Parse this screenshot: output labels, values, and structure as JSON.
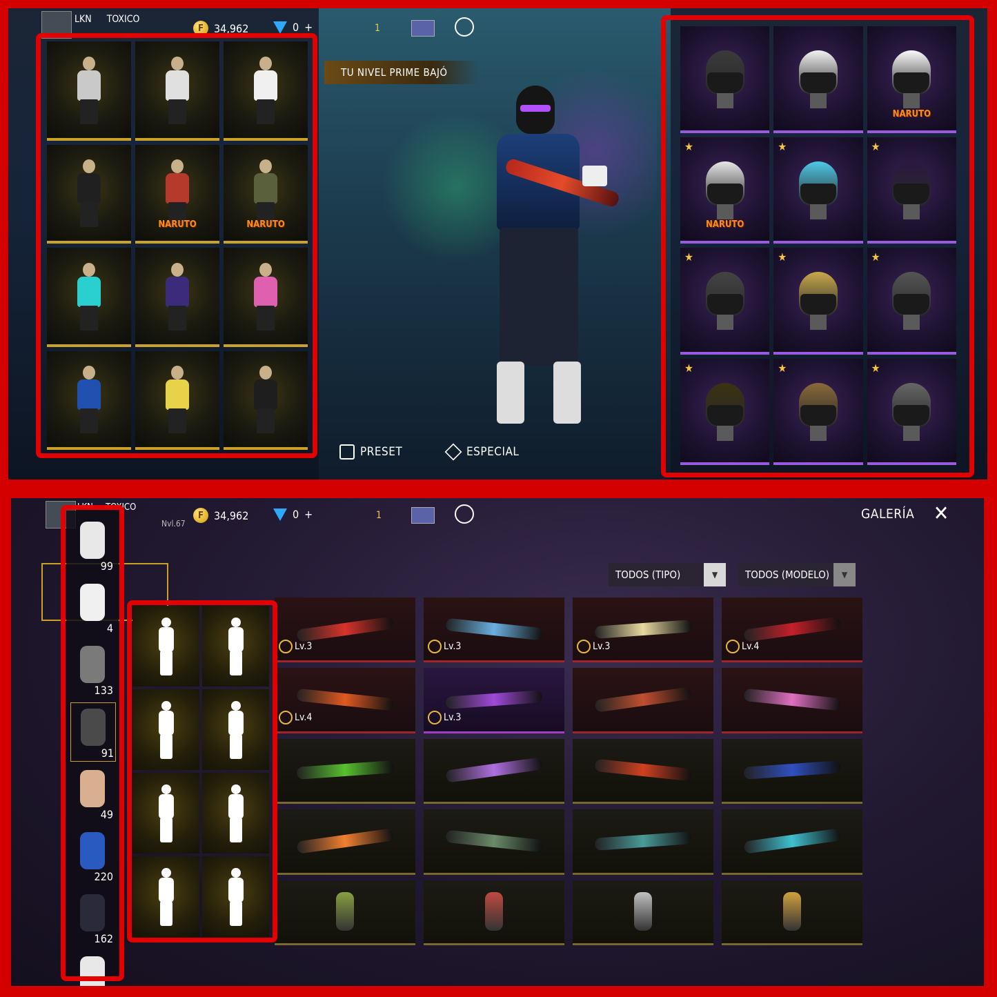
{
  "top": {
    "player": {
      "tag": "LKN",
      "name": "TOXICO"
    },
    "coins": "34,962",
    "diamonds": "0",
    "diamonds_plus": "+",
    "rank_level": "1",
    "banner": "TU NIVEL PRIME BAJÓ",
    "buttons": {
      "preset": "PRESET",
      "special": "ESPECIAL"
    },
    "outfit_tiles": [
      {
        "icon": "outfit-icon"
      },
      {
        "icon": "outfit-icon"
      },
      {
        "icon": "outfit-icon"
      },
      {
        "icon": "outfit-icon"
      },
      {
        "icon": "outfit-icon",
        "badge": "NARUTO"
      },
      {
        "icon": "outfit-icon",
        "badge": "NARUTO"
      },
      {
        "icon": "outfit-icon"
      },
      {
        "icon": "outfit-icon"
      },
      {
        "icon": "outfit-icon"
      },
      {
        "icon": "outfit-icon"
      },
      {
        "icon": "outfit-icon"
      },
      {
        "icon": "outfit-icon"
      }
    ],
    "head_tiles": [
      {
        "star": false
      },
      {
        "star": false
      },
      {
        "star": false,
        "badge": "NARUTO"
      },
      {
        "star": true,
        "badge": "NARUTO"
      },
      {
        "star": true
      },
      {
        "star": true
      },
      {
        "star": true
      },
      {
        "star": true
      },
      {
        "star": true
      },
      {
        "star": true
      },
      {
        "star": true
      },
      {
        "star": true
      }
    ]
  },
  "bottom": {
    "player": {
      "tag": "LKN",
      "name": "TOXICO",
      "level": "Nvl.67"
    },
    "coins": "34,962",
    "diamonds": "0",
    "diamonds_plus": "+",
    "rank_level": "1",
    "title": "GALERÍA",
    "filters": {
      "type": "TODOS (TIPO)",
      "model": "TODOS (MODELO)"
    },
    "categories": [
      {
        "icon": "outfit-set-icon",
        "count": "99"
      },
      {
        "icon": "jumpsuit-icon",
        "count": "4"
      },
      {
        "icon": "head-icon",
        "count": "133"
      },
      {
        "icon": "mask-icon",
        "count": "91"
      },
      {
        "icon": "face-icon",
        "count": "49"
      },
      {
        "icon": "jacket-icon",
        "count": "220"
      },
      {
        "icon": "pants-icon",
        "count": "162"
      },
      {
        "icon": "shoes-icon",
        "count": ""
      }
    ],
    "emote_tiles": [
      {
        "icon": "emote-heart-icon"
      },
      {
        "icon": "emote-drink-icon"
      },
      {
        "icon": "emote-dance-icon"
      },
      {
        "icon": "emote-beach-chair-icon"
      },
      {
        "icon": "emote-lotus-icon"
      },
      {
        "icon": "emote-broken-heart-icon"
      },
      {
        "icon": "emote-car-icon"
      },
      {
        "icon": "emote-cheer-icon"
      }
    ],
    "weapon_tiles": [
      {
        "level": "Lv.3",
        "style": "red"
      },
      {
        "level": "Lv.3",
        "style": "red"
      },
      {
        "level": "Lv.3",
        "style": "red"
      },
      {
        "level": "Lv.4",
        "style": "red"
      },
      {
        "level": "Lv.4",
        "style": "red"
      },
      {
        "level": "Lv.3",
        "style": "violet"
      },
      {
        "level": "",
        "style": "red"
      },
      {
        "level": "",
        "style": "red"
      },
      {
        "level": "",
        "style": "gold"
      },
      {
        "level": "",
        "style": "gold"
      },
      {
        "level": "",
        "style": "gold"
      },
      {
        "level": "",
        "style": "gold"
      },
      {
        "level": "",
        "style": "gold"
      },
      {
        "level": "",
        "style": "gold"
      },
      {
        "level": "",
        "style": "gold"
      },
      {
        "level": "",
        "style": "gold"
      },
      {
        "level": "",
        "style": "gold"
      },
      {
        "level": "",
        "style": "gold"
      },
      {
        "level": "",
        "style": "gold"
      },
      {
        "level": "",
        "style": "gold"
      }
    ]
  }
}
